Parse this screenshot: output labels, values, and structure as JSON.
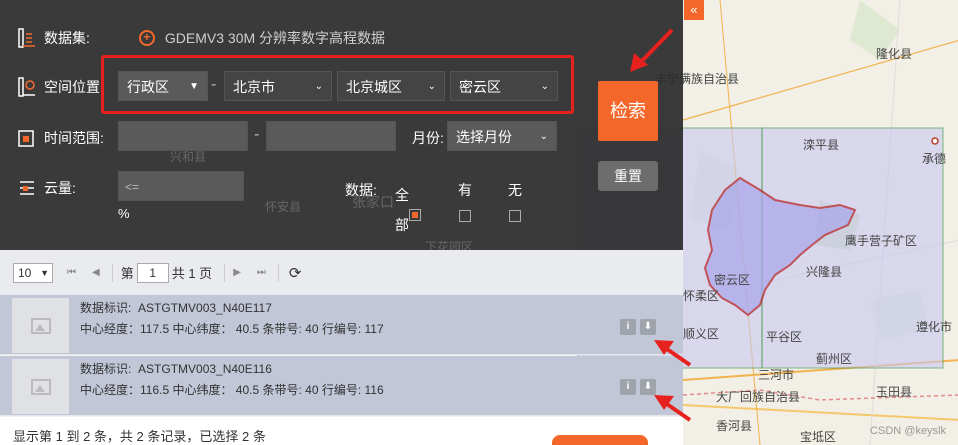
{
  "map": {
    "collapse_glyph": "«",
    "watermark": "CSDN @keyslk",
    "labels": [
      {
        "id": "longhua",
        "text": "隆化县"
      },
      {
        "id": "fengning",
        "text": "丰宁满族自治县"
      },
      {
        "id": "luanping",
        "text": "滦平县"
      },
      {
        "id": "chengde",
        "text": "承德"
      },
      {
        "id": "yingshouyingzi",
        "text": "鹰手营子矿区"
      },
      {
        "id": "xinglong",
        "text": "兴隆县"
      },
      {
        "id": "miyun",
        "text": "密云区"
      },
      {
        "id": "huairou",
        "text": "怀柔区"
      },
      {
        "id": "shunyi",
        "text": "顺义区"
      },
      {
        "id": "pinggu",
        "text": "平谷区"
      },
      {
        "id": "zunhua",
        "text": "遵化市"
      },
      {
        "id": "jizhou",
        "text": "蓟州区"
      },
      {
        "id": "sanhe",
        "text": "三河市"
      },
      {
        "id": "yutian",
        "text": "玉田县"
      },
      {
        "id": "dachang",
        "text": "大厂回族自治县"
      },
      {
        "id": "xianghe",
        "text": "香河县"
      },
      {
        "id": "baodi",
        "text": "宝坻区"
      },
      {
        "id": "zhangjiakou",
        "text": "张家口"
      },
      {
        "id": "huaian",
        "text": "怀安县"
      },
      {
        "id": "xinghe",
        "text": "兴和县"
      },
      {
        "id": "xiahuayuan",
        "text": "下花园区"
      }
    ]
  },
  "panel": {
    "dataset": {
      "label": "数据集:",
      "value": "GDEMV3 30M 分辨率数字高程数据"
    },
    "location": {
      "label": "空间位置",
      "type_select": "行政区",
      "province_select": "北京市",
      "city_select": "北京城区",
      "district_select": "密云区",
      "separator": "-"
    },
    "time": {
      "label": "时间范围:",
      "separator": "-",
      "month_label": "月份:",
      "month_select": "选择月份"
    },
    "cloud": {
      "label": "云量:",
      "placeholder": "<=",
      "unit": "%"
    },
    "data_filter": {
      "label": "数据:",
      "options": [
        "全部",
        "有",
        "无"
      ],
      "selected": "全部"
    },
    "search_button": "检索",
    "reset_button": "重置"
  },
  "pager": {
    "page_size": "10",
    "page_prefix": "第",
    "page_value": "1",
    "page_suffix": "共 1 页"
  },
  "results": [
    {
      "id_label": "数据标识:",
      "id_value": "ASTGTMV003_N40E117",
      "detail": "中心经度：117.5 中心纬度：  40.5 条带号: 40 行编号: 117"
    },
    {
      "id_label": "数据标识:",
      "id_value": "ASTGTMV003_N40E116",
      "detail": "中心经度：116.5 中心纬度：  40.5 条带号: 40 行编号: 116"
    }
  ],
  "footer": {
    "summary": "显示第 1 到 2 条，共 2 条记录，已选择 2 条"
  },
  "colors": {
    "accent": "#f3682a",
    "annotation": "#e6211e",
    "panel_bg": "#2a2a2a",
    "tile_fill": "#c9c8f0",
    "district_border": "#b71c1c"
  }
}
